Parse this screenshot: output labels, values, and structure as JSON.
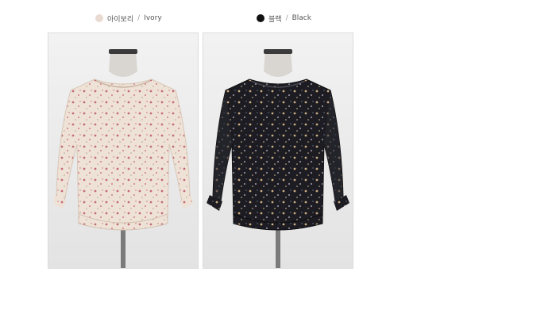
{
  "variants": [
    {
      "name_ko": "아이보리",
      "separator": "/",
      "name_en": "Ivory",
      "swatch_color": "#eadbd2"
    },
    {
      "name_ko": "블랙",
      "separator": "/",
      "name_en": "Black",
      "swatch_color": "#111111"
    }
  ],
  "colors": {
    "photo_background": "#ededed",
    "ivory_fabric": "#eee2d6",
    "ivory_print": "#c46b78",
    "black_fabric": "#1c1c22",
    "black_print": "#c9ab82"
  }
}
